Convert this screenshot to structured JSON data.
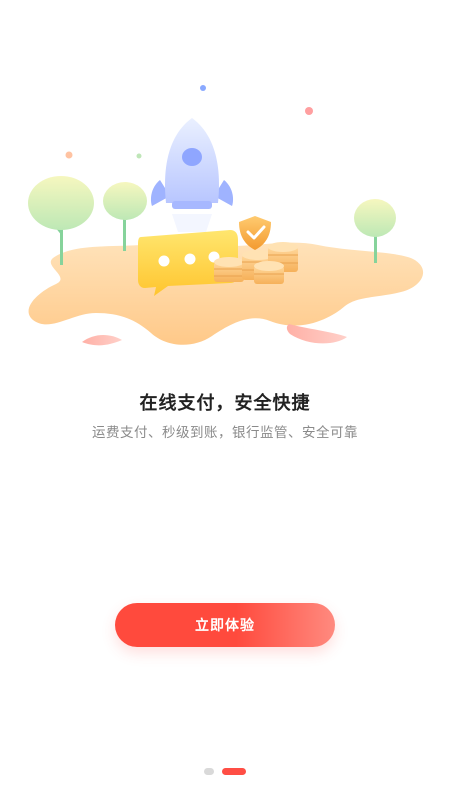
{
  "onboarding": {
    "title": "在线支付，安全快捷",
    "subtitle": "运费支付、秒级到账，银行监管、安全可靠",
    "cta_label": "立即体验",
    "colors": {
      "accent_start": "#ff4a3d",
      "accent_end": "#ff8a7f",
      "title": "#222222",
      "subtitle": "#8a8a8a",
      "dot_inactive": "#d9d9d9",
      "dot_active": "#ff4e45"
    }
  },
  "pagination": {
    "total": 2,
    "active_index": 1
  },
  "illustration": {
    "elements": [
      "rocket-icon",
      "tree-icon",
      "chat-bubble-icon",
      "shield-check-icon",
      "coin-stack-icon"
    ]
  }
}
